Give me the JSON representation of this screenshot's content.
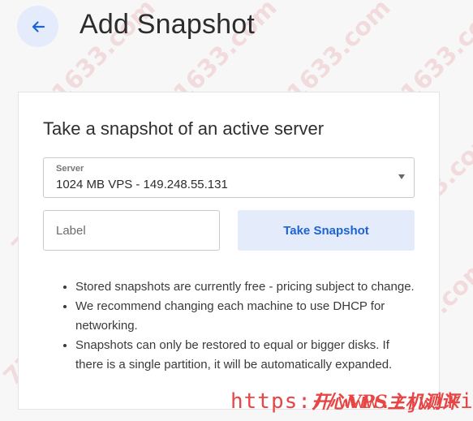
{
  "header": {
    "title": "Add Snapshot",
    "back_icon": "arrow-left-icon"
  },
  "card": {
    "heading": "Take a snapshot of an active server",
    "server_select": {
      "label": "Server",
      "value": "1024 MB VPS - 149.248.55.131",
      "icon": "caret-down-icon"
    },
    "label_input": {
      "value": "",
      "placeholder": "Label"
    },
    "submit_label": "Take Snapshot",
    "notes": [
      "Stored snapshots are currently free - pricing subject to change.",
      "We recommend changing each machine to use DHCP for networking.",
      "Snapshots can only be restored to equal or bigger disks. If there is a single partition, it will be automatically expanded."
    ]
  },
  "watermark": {
    "url_text": "https://www.zjwiki.com",
    "site_name": "开心VPS主机测评",
    "repeat_text": "771633.com"
  },
  "colors": {
    "accent": "#1d63d8",
    "accent_bg": "#e4ebfa",
    "page_bg": "#f7f7f8",
    "watermark": "#e84545"
  }
}
